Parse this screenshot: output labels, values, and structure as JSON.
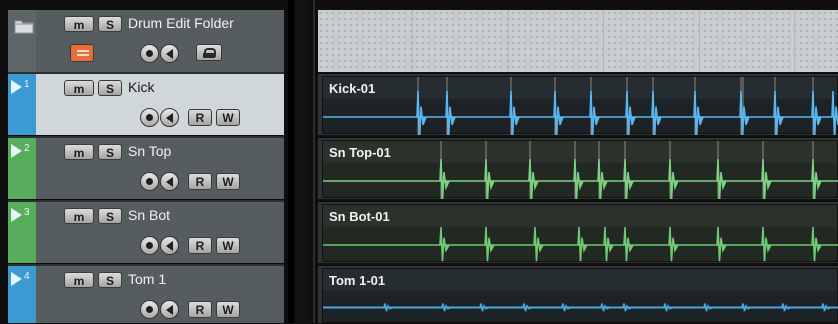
{
  "folder_track": {
    "name": "Drum Edit Folder",
    "mute_label": "m",
    "solo_label": "S"
  },
  "tracks": [
    {
      "number": "1",
      "name": "Kick",
      "mute_label": "m",
      "solo_label": "S",
      "read_label": "R",
      "write_label": "W",
      "color": "#3c9ad2",
      "selected": true
    },
    {
      "number": "2",
      "name": "Sn Top",
      "mute_label": "m",
      "solo_label": "S",
      "read_label": "R",
      "write_label": "W",
      "color": "#58ad5c",
      "selected": false
    },
    {
      "number": "3",
      "name": "Sn Bot",
      "mute_label": "m",
      "solo_label": "S",
      "read_label": "R",
      "write_label": "W",
      "color": "#58ad5c",
      "selected": false
    },
    {
      "number": "4",
      "name": "Tom 1",
      "mute_label": "m",
      "solo_label": "S",
      "read_label": "R",
      "write_label": "W",
      "color": "#3c9ad2",
      "selected": false
    }
  ],
  "clips": [
    {
      "name": "Kick-01",
      "color": "#3c9ad2",
      "head_color": "#262d31",
      "body_color": "#1d2226",
      "wave_color": "#5ab7ee"
    },
    {
      "name": "Sn Top-01",
      "color": "#58ad5c",
      "head_color": "#2a322b",
      "body_color": "#222822",
      "wave_color": "#7cd080"
    },
    {
      "name": "Sn Bot-01",
      "color": "#58ad5c",
      "head_color": "#2a322b",
      "body_color": "#222822",
      "wave_color": "#6fc873"
    },
    {
      "name": "Tom 1-01",
      "color": "#3c9ad2",
      "head_color": "#262d31",
      "body_color": "#1d2226",
      "wave_color": "#4aa6de"
    }
  ],
  "icons": {
    "folder": "folder-icon",
    "play": "play-triangle-icon",
    "record_enable": "record-enable-icon",
    "monitor": "monitor-speaker-icon",
    "lock": "lock-icon",
    "folder_menu": "folder-menu-icon"
  }
}
